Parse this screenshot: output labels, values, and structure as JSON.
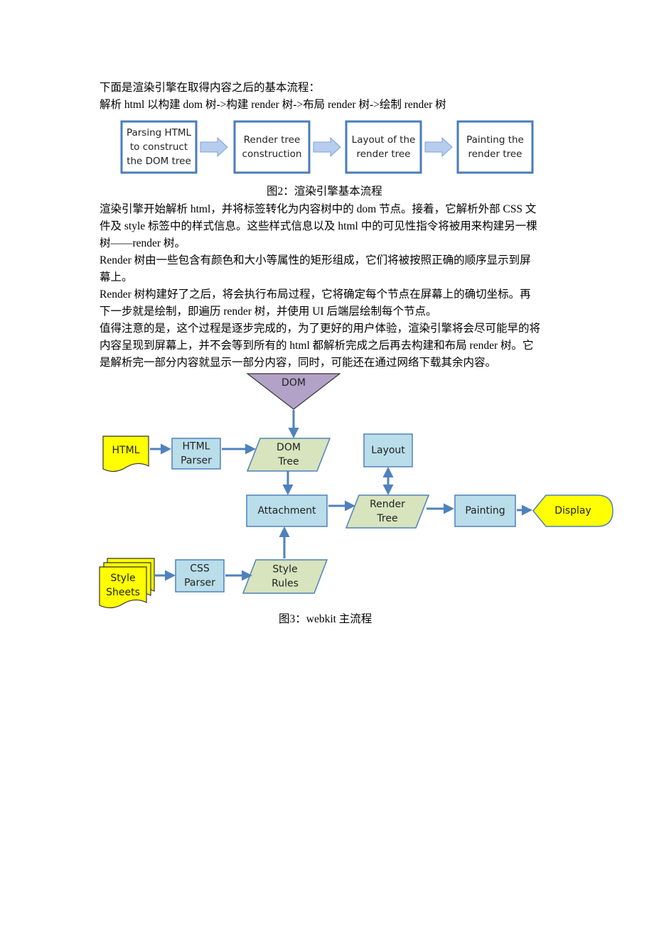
{
  "intro": {
    "line1": "下面是渲染引擎在取得内容之后的基本流程：",
    "line2": "解析 html 以构建 dom 树->构建 render 树->布局 render 树->绘制 render 树"
  },
  "figure2": {
    "steps": [
      {
        "lines": [
          "Parsing HTML",
          "to construct",
          "the DOM tree"
        ]
      },
      {
        "lines": [
          "Render tree",
          "construction"
        ]
      },
      {
        "lines": [
          "Layout of the",
          "render tree"
        ]
      },
      {
        "lines": [
          "Painting the",
          "render tree"
        ]
      }
    ],
    "caption": "图2：渲染引擎基本流程",
    "colors": {
      "box_border": "#4a7bbf",
      "arrow_fill": "#b7cdef",
      "arrow_stroke": "#7da2d6"
    }
  },
  "body": {
    "p1": [
      "渲染引擎开始解析 html，并将标签转化为内容树中的 dom 节点。接着，它解析外部 CSS 文",
      "件及 style 标签中的样式信息。这些样式信息以及 html 中的可见性指令将被用来构建另一棵",
      "树——render 树。"
    ],
    "p2": [
      "Render 树由一些包含有颜色和大小等属性的矩形组成，它们将被按照正确的顺序显示到屏",
      "幕上。"
    ],
    "p3": [
      "Render 树构建好了之后，将会执行布局过程，它将确定每个节点在屏幕上的确切坐标。再",
      "下一步就是绘制，即遍历 render 树，并使用 UI 后端层绘制每个节点。"
    ],
    "p4": [
      "值得注意的是，这个过程是逐步完成的，为了更好的用户体验，渲染引擎将会尽可能早的将",
      "内容呈现到屏幕上，并不会等到所有的 html 都解析完成之后再去构建和布局 render 树。它",
      "是解析完一部分内容就显示一部分内容，同时，可能还在通过网络下载其余内容。"
    ]
  },
  "figure3": {
    "nodes": {
      "dom": "DOM",
      "html": "HTML",
      "html_parser": [
        "HTML",
        "Parser"
      ],
      "dom_tree": [
        "DOM",
        "Tree"
      ],
      "layout": "Layout",
      "attachment": "Attachment",
      "render_tree": [
        "Render",
        "Tree"
      ],
      "painting": "Painting",
      "display": "Display",
      "style_sheets": [
        "Style",
        "Sheets"
      ],
      "css_parser": [
        "CSS",
        "Parser"
      ],
      "style_rules": [
        "Style",
        "Rules"
      ]
    },
    "caption": "图3：webkit 主流程",
    "colors": {
      "process_fill": "#b9dde9",
      "data_fill": "#d7e4bd",
      "doc_fill": "#ffff00",
      "dom_fill": "#b2a2c7",
      "stroke": "#4f81bd",
      "arrow": "#4f81bd"
    }
  }
}
